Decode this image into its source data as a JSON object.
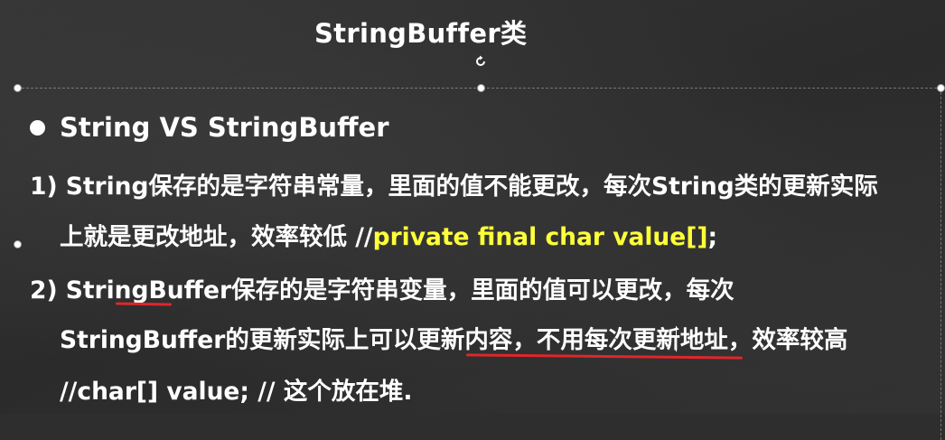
{
  "slide": {
    "title": "StringBuffer类",
    "bullet_heading": "String VS StringBuffer",
    "point1": {
      "line1": "1) String保存的是字符串常量，里面的值不能更改，每次String类的更新实际",
      "line2_main": "上就是更改地址，效率较低 //",
      "line2_code": "private final char value[]",
      "line2_end": ";"
    },
    "point2": {
      "line1": "2) StringBuffer保存的是字符串变量，里面的值可以更改，每次",
      "line2": "StringBuffer的更新实际上可以更新内容，不用每次更新地址，效率较高",
      "line3": "//char[] value;   // 这个放在堆."
    }
  },
  "colors": {
    "background": "#2e2e2e",
    "text": "#ffffff",
    "code_highlight": "#ffff3a",
    "annotation_red": "#e0262a"
  },
  "icons": {
    "rotate": "rotate-handle-icon",
    "resize": "resize-handle-icon"
  }
}
